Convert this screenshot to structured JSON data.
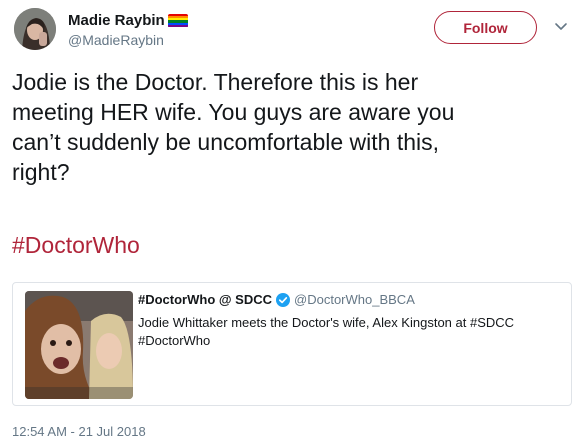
{
  "author": {
    "display_name": "Madie Raybin",
    "handle": "@MadieRaybin",
    "flag_colors": [
      "#e40303",
      "#ff8c00",
      "#ffed00",
      "#008026",
      "#004dff",
      "#750787"
    ]
  },
  "actions": {
    "follow_label": "Follow",
    "caret_icon": "chevron-down-icon"
  },
  "tweet": {
    "text": "Jodie is the Doctor. Therefore this is her\nmeeting HER wife. You guys are aware you\ncan’t suddenly be uncomfortable with this,\nright?",
    "hashtag": "#DoctorWho",
    "timestamp": "12:54 AM - 21 Jul 2018"
  },
  "quoted_tweet": {
    "display_name": "#DoctorWho @ SDCC",
    "verified_icon": "verified-badge-icon",
    "handle": "@DoctorWho_BBCA",
    "text": "Jodie Whittaker meets the Doctor's wife, Alex Kingston at #SDCC\n#DoctorWho"
  },
  "colors": {
    "accent": "#b0253a",
    "secondary_text": "#657786",
    "border": "#dfe3e8",
    "verified": "#1da1f2"
  }
}
